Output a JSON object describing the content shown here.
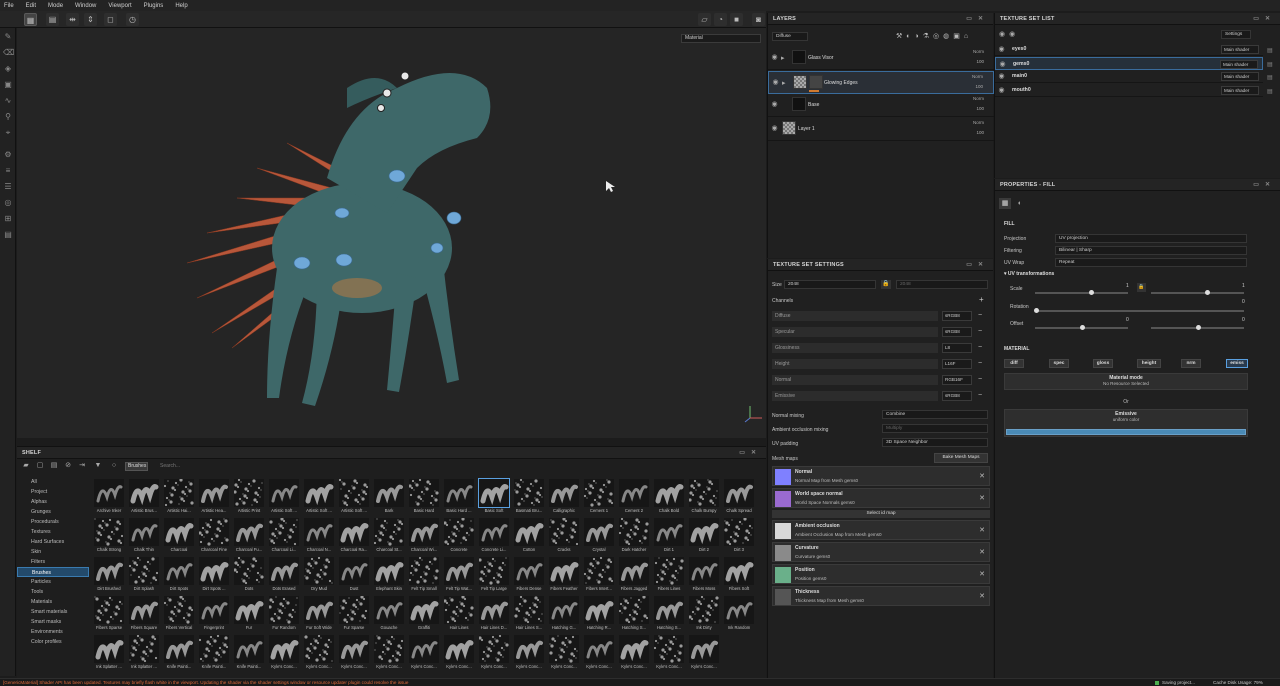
{
  "menu": [
    "File",
    "Edit",
    "Mode",
    "Window",
    "Viewport",
    "Plugins",
    "Help"
  ],
  "viewport": {
    "material_select": "Material"
  },
  "shelf": {
    "title": "SHELF",
    "tag": "Brushes",
    "search_placeholder": "Search...",
    "categories": [
      "All",
      "Project",
      "Alphas",
      "Grunges",
      "Procedurals",
      "Textures",
      "Hard Surfaces",
      "Skin",
      "Filters",
      "Brushes",
      "Particles",
      "Tools",
      "Materials",
      "Smart materials",
      "Smart masks",
      "Environments",
      "Color profiles"
    ],
    "selected_category": "Brushes",
    "brushes": [
      "Archive Inker",
      "Artistic Brus...",
      "Artistic Hai...",
      "Artistic Hea...",
      "Artistic Print",
      "Artistic Soft ...",
      "Artistic Soft ...",
      "Artistic Soft ...",
      "Bark",
      "Basic Hard",
      "Basic Hard ...",
      "Basic Soft",
      "Basmati Bru...",
      "Calligraphic",
      "Cement 1",
      "Cement 2",
      "Chalk Bold",
      "Chalk Bumpy",
      "Chalk Spread",
      "Chalk Strong",
      "Chalk Thin",
      "Charcoal",
      "Charcoal Fine",
      "Charcoal Fu...",
      "Charcoal Li...",
      "Charcoal N...",
      "Charcoal Ra...",
      "Charcoal St...",
      "Charcoal Wi...",
      "Concrete",
      "Concrete Li...",
      "Cotton",
      "Cracks",
      "Crystal",
      "Dark Hatcher",
      "Dirt 1",
      "Dirt 2",
      "Dirt 3",
      "Dirt Brushed",
      "Dirt Splash",
      "Dirt Spots",
      "Dirt Spots ...",
      "Dots",
      "Dots Erased",
      "Dry Mud",
      "Dust",
      "Elephant Skin",
      "Felt Tip Small",
      "Felt Tip Wat...",
      "Felt Tip Large",
      "Fibers Dense",
      "Fibers Feather",
      "Fibers Intert...",
      "Fibers Jagged",
      "Fibers Lines",
      "Fibers Moss",
      "Fibers Soft",
      "Fibers Sparse",
      "Fibers Square",
      "Fibers Vertical",
      "Fingerprint",
      "Fur",
      "Fur Random",
      "Fur Soft Wide",
      "Fur Sparse",
      "Gouache",
      "Graffiti",
      "Hair Lines",
      "Hair Lines D...",
      "Hair Lines S...",
      "Hatching G...",
      "Hatching R...",
      "Hatching S...",
      "Hatching S...",
      "Ink Dirty",
      "Ink Random",
      "Ink Splatter ...",
      "Ink Splatter ...",
      "Knife Painti...",
      "Knife Painti...",
      "Knife Painti...",
      "Kyle's Conc...",
      "Kyle's Conc...",
      "Kyle's Conc...",
      "Kyle's Conc...",
      "Kyle's Conc...",
      "Kyle's Conc...",
      "Kyle's Conc...",
      "Kyle's Conc...",
      "Kyle's Conc...",
      "Kyle's Conc...",
      "Kyle's Conc...",
      "Kyle's Conc...",
      "Kyle's Conc..."
    ],
    "selected_brush": "Basic Soft"
  },
  "layers": {
    "title": "LAYERS",
    "channel": "Diffuse",
    "items": [
      {
        "name": "Glass Visor",
        "blend": "Norm",
        "opacity": "100"
      },
      {
        "name": "Glowing Edges",
        "blend": "Norm",
        "opacity": "100"
      },
      {
        "name": "Base",
        "blend": "Norm",
        "opacity": "100"
      },
      {
        "name": "Layer 1",
        "blend": "Norm",
        "opacity": "100"
      }
    ]
  },
  "texture_set_settings": {
    "title": "TEXTURE SET SETTINGS",
    "size_label": "Size",
    "size": "2048",
    "size_linked": "2048",
    "channels_label": "Channels",
    "channels": [
      {
        "name": "Diffuse",
        "format": "sRGB8"
      },
      {
        "name": "Specular",
        "format": "sRGB8"
      },
      {
        "name": "Glossiness",
        "format": "L8"
      },
      {
        "name": "Height",
        "format": "L16F"
      },
      {
        "name": "Normal",
        "format": "RGB16F"
      },
      {
        "name": "Emissive",
        "format": "sRGB8"
      }
    ],
    "normal_mixing_label": "Normal mixing",
    "normal_mixing": "Combine",
    "ao_mixing_label": "Ambient occlusion mixing",
    "ao_mixing": "Multiply",
    "uv_padding_label": "UV padding",
    "uv_padding": "3D Space Neighbor",
    "mesh_maps_label": "Mesh maps",
    "bake_button": "Bake Mesh Maps",
    "select_id_map": "Select id map",
    "mesh_maps": [
      {
        "name": "Normal",
        "desc": "Normal Map from Mesh gems0",
        "color": "#7f80ff"
      },
      {
        "name": "World space normal",
        "desc": "World Space Normals gems0",
        "color": "#9a6ad0"
      },
      {
        "name": "Ambient occlusion",
        "desc": "Ambient Occlusion Map from Mesh gems0",
        "color": "#d8d8d8"
      },
      {
        "name": "Curvature",
        "desc": "Curvature gems0",
        "color": "#8a8a8a"
      },
      {
        "name": "Position",
        "desc": "Position gems0",
        "color": "#6ab08a"
      },
      {
        "name": "Thickness",
        "desc": "Thickness Map from Mesh gems0",
        "color": "#555555"
      }
    ]
  },
  "texture_set_list": {
    "title": "TEXTURE SET LIST",
    "settings_label": "Settings",
    "items": [
      {
        "name": "eyes0",
        "shader": "Main shader"
      },
      {
        "name": "gems0",
        "shader": "Main shader"
      },
      {
        "name": "main0",
        "shader": "Main shader"
      },
      {
        "name": "mouth0",
        "shader": "Main shader"
      }
    ]
  },
  "properties": {
    "title": "PROPERTIES - FILL",
    "section_fill": "FILL",
    "projection_label": "Projection",
    "projection": "UV projection",
    "filtering_label": "Filtering",
    "filtering": "Bilinear | Sharp",
    "uvwrap_label": "UV Wrap",
    "uvwrap": "Repeat",
    "uv_transformations": "UV transformations",
    "scale_label": "Scale",
    "scale_value": "1",
    "scale_value2": "1",
    "rotation_label": "Rotation",
    "rotation_value": "0",
    "offset_label": "Offset",
    "offset_value": "0",
    "offset_value2": "0",
    "section_material": "MATERIAL",
    "material_buttons": [
      "diff",
      "spec",
      "gloss",
      "height",
      "nrm",
      "emiss"
    ],
    "material_mode_label": "Material mode",
    "no_resource": "No Resource Selected",
    "or_label": "Or",
    "emissive_label": "Emissive",
    "uniform_color": "uniform color"
  },
  "status": {
    "message": "[GenericMaterial] Shader API has been updated. Textures may briefly flash white in the viewport. Updating the shader via the shader settings window or resource updater plugin could resolve the issue",
    "saving": "Saving project...",
    "cache": "Cache Disk Usage:",
    "cache_value": "79%"
  },
  "colors": {
    "accent": "#3a7bb0",
    "emissive": "#4a8ab5",
    "warning": "#e06a3b",
    "creature_body": "#3f6a6a",
    "spikes": "#c0603a",
    "gems": "#6fa8d8"
  }
}
